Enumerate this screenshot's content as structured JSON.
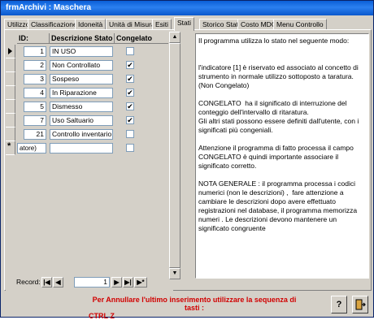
{
  "window": {
    "title": "frmArchivi : Maschera"
  },
  "tabs": [
    {
      "label": "Utilizzo"
    },
    {
      "label": "Classificazione"
    },
    {
      "label": "Idoneità"
    },
    {
      "label": "Unità di Misura"
    },
    {
      "label": "Esiti"
    },
    {
      "label": "Stati"
    },
    {
      "label": "Storico Stati"
    },
    {
      "label": "Costo MDO"
    },
    {
      "label": "Menu Controllo"
    }
  ],
  "active_tab": "Stati",
  "grid": {
    "headers": {
      "id": "ID:",
      "desc": "Descrizione Stato",
      "cong": "Congelato"
    },
    "rows": [
      {
        "id": "1",
        "desc": "IN USO",
        "congelato": false
      },
      {
        "id": "2",
        "desc": "Non Controllato",
        "congelato": true
      },
      {
        "id": "3",
        "desc": "Sospeso",
        "congelato": true
      },
      {
        "id": "4",
        "desc": "In Riparazione",
        "congelato": true
      },
      {
        "id": "5",
        "desc": "Dismesso",
        "congelato": true
      },
      {
        "id": "7",
        "desc": "Uso Saltuario",
        "congelato": true
      },
      {
        "id": "21",
        "desc": "Controllo inventario",
        "congelato": false
      }
    ],
    "new_row": {
      "id": "atore)",
      "desc": "",
      "congelato": false
    }
  },
  "navigator": {
    "label": "Record:",
    "current": "1"
  },
  "info_text": "Il programma utilizza lo stato nel seguente modo:\n\n\nl'indicatore [1] è riservato ed associato al concetto di strumento in normale utilizzo sottoposto a taratura. (Non Congelato)\n\nCONGELATO  ha il significato di interruzione del conteggio dell'intervallo di ritaratura.\nGli altri stati possono essere definiti dall'utente, con i significati più congeniali.\n\nAttenzione il programma di fatto processa il campo CONGELATO è quindi importante associare il significato corretto.\n\nNOTA GENERALE : il programma processa i codici numerici (non le descrizioni) ,  fare attenzione a cambiare le descrizioni dopo avere effettuato registrazioni nel database, il programma memorizza numeri . Le descrizioni devono mantenere un significato congruente",
  "footer": {
    "message_line1": "Per Annullare l'ultimo inserimento utilizzare la sequenza di tasti :",
    "message_line2": "CTRL Z",
    "help_icon": "?",
    "exit_icon": "exit-door"
  },
  "colors": {
    "titlebar": "#0b5fd8",
    "warning_text": "#d10000"
  }
}
